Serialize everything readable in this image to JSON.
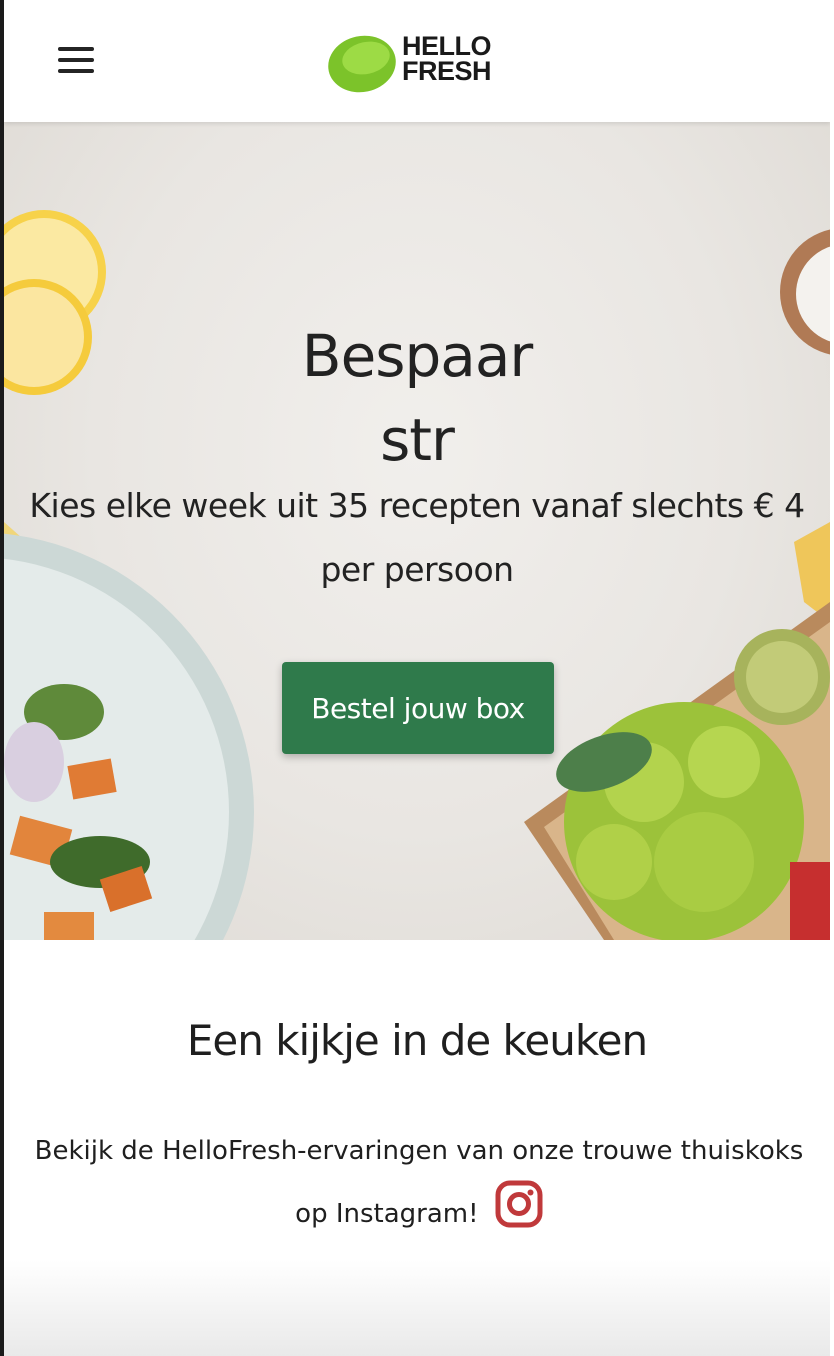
{
  "header": {
    "menu_icon": "hamburger-menu-icon",
    "logo_icon": "lime-logo-icon",
    "logo_line1": "HELLO",
    "logo_line2": "FRESH"
  },
  "hero": {
    "title_line1": "Bespaar",
    "title_line2": "str",
    "subtitle": "Kies elke week uit 35 recepten vanaf slechts € 4 per persoon",
    "cta_label": "Bestel jouw box"
  },
  "section": {
    "title": "Een kijkje in de keuken",
    "text": "Bekijk de HelloFresh-ervaringen van onze trouwe thuiskoks op Instagram!",
    "instagram_icon": "instagram-icon"
  },
  "colors": {
    "brand_green": "#2f7a4b",
    "logo_lime": "#8ccf2f",
    "instagram": "#c0393b"
  }
}
